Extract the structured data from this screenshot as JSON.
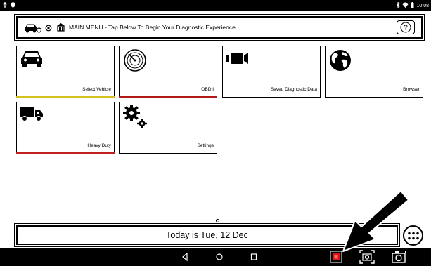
{
  "statusbar": {
    "left_icons": [
      "usb-icon",
      "shield-icon"
    ],
    "right_icons": [
      "bluetooth-icon",
      "wifi-icon",
      "battery-icon"
    ],
    "time": "10:08"
  },
  "header": {
    "title": "MAIN MENU - Tap Below To Begin Your Diagnostic Experience",
    "help_label": "?"
  },
  "tiles": [
    {
      "label": "Select Vehicle",
      "icon": "car-icon",
      "stripe": "#d4c21a"
    },
    {
      "label": "OBDII",
      "icon": "radar-icon",
      "stripe": "#b01717"
    },
    {
      "label": "Saved Diagnostic Data",
      "icon": "video-camera-icon",
      "stripe": ""
    },
    {
      "label": "Browser",
      "icon": "globe-icon",
      "stripe": ""
    },
    {
      "label": "Heavy Duty",
      "icon": "truck-icon",
      "stripe": "#c0211c"
    },
    {
      "label": "Settings",
      "icon": "gears-icon",
      "stripe": ""
    }
  ],
  "footer": {
    "date_text": "Today is Tue, 12 Dec"
  },
  "navbar": {
    "buttons": [
      "back-icon",
      "home-icon",
      "recents-icon",
      "record-icon",
      "screenshot-icon",
      "camera-icon"
    ]
  },
  "colors": {
    "accent_yellow": "#d4c21a",
    "accent_red": "#b01717",
    "record_red": "#e01010"
  }
}
